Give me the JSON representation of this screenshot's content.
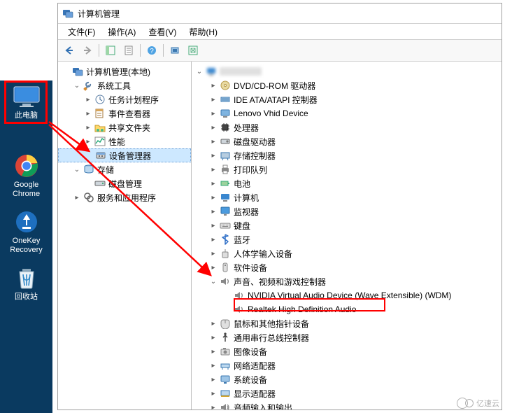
{
  "desktop": {
    "this_pc": "此电脑",
    "chrome1": "Google",
    "chrome2": "Chrome",
    "onekey1": "OneKey",
    "onekey2": "Recovery",
    "recycle": "回收站"
  },
  "window": {
    "title": "计算机管理"
  },
  "menu": {
    "file": "文件(F)",
    "action": "操作(A)",
    "view": "查看(V)",
    "help": "帮助(H)"
  },
  "left_tree": {
    "root": "计算机管理(本地)",
    "system_tools": "系统工具",
    "task_scheduler": "任务计划程序",
    "event_viewer": "事件查看器",
    "shared_folders": "共享文件夹",
    "performance": "性能",
    "device_manager": "设备管理器",
    "storage": "存储",
    "disk_management": "磁盘管理",
    "services_apps": "服务和应用程序"
  },
  "right_tree": {
    "dvd": "DVD/CD-ROM 驱动器",
    "ide": "IDE ATA/ATAPI 控制器",
    "lenovo": "Lenovo Vhid Device",
    "cpu": "处理器",
    "disk_drives": "磁盘驱动器",
    "storage_ctrl": "存储控制器",
    "print_queue": "打印队列",
    "battery": "电池",
    "computer": "计算机",
    "monitor": "监视器",
    "keyboard": "键盘",
    "bluetooth": "蓝牙",
    "hid": "人体学输入设备",
    "software_dev": "软件设备",
    "sound_ctrl": "声音、视频和游戏控制器",
    "nvidia": "NVIDIA Virtual Audio Device (Wave Extensible) (WDM)",
    "realtek": "Realtek High Definition Audio",
    "mouse": "鼠标和其他指针设备",
    "usb": "通用串行总线控制器",
    "imaging": "图像设备",
    "network": "网络适配器",
    "system_dev": "系统设备",
    "display": "显示适配器",
    "audio_io": "音频输入和输出"
  },
  "watermark": "亿速云"
}
